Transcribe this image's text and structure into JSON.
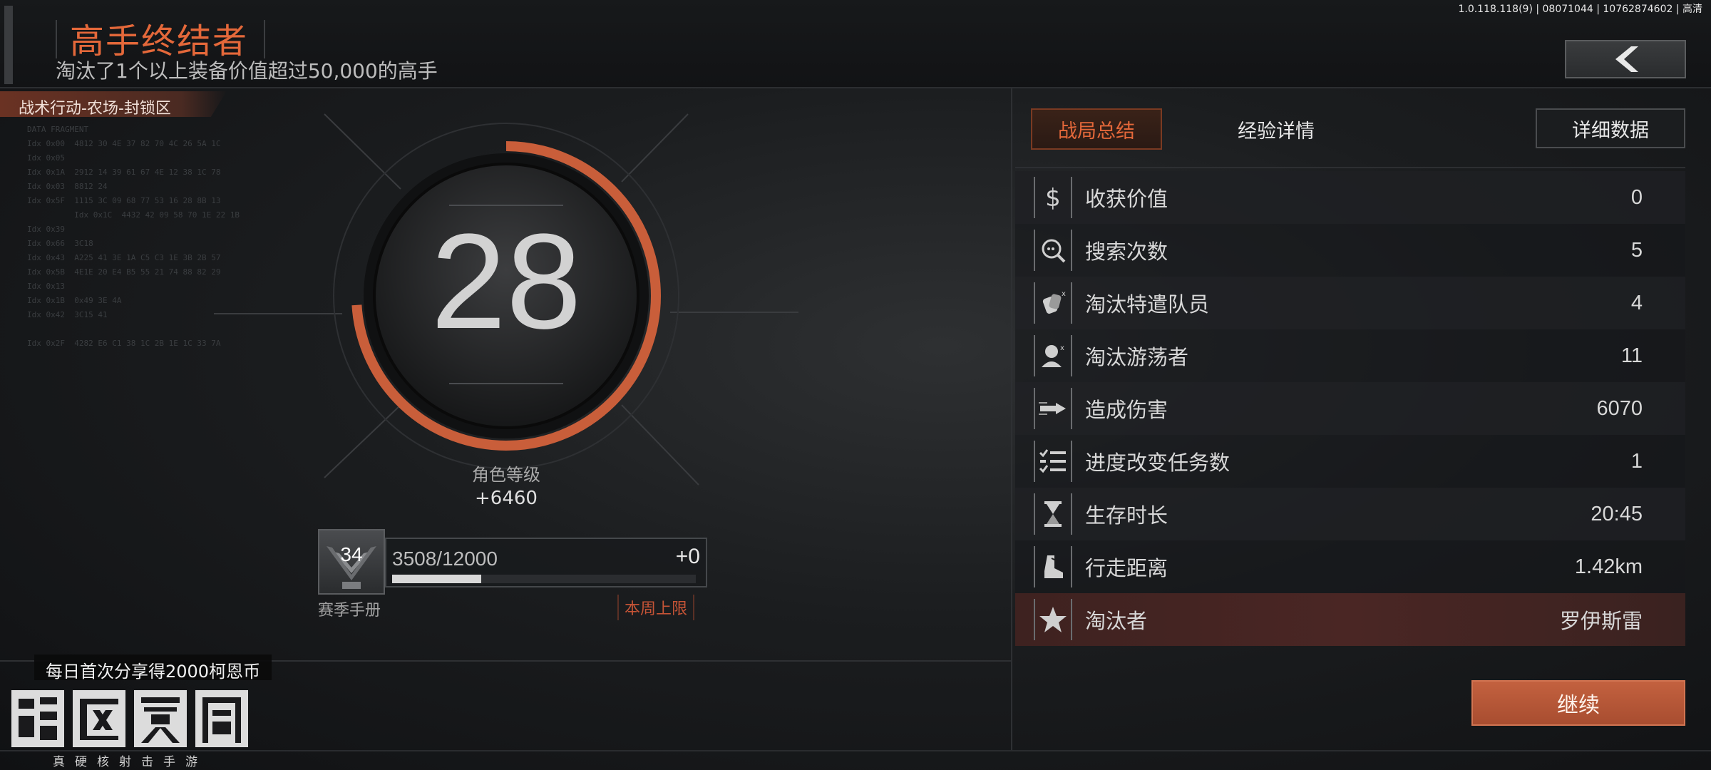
{
  "build_info": "1.0.118.118(9) | 08071044 | 10762874602 | 高清",
  "achievement": {
    "title": "高手终结者",
    "subtitle": "淘汰了1个以上装备价值超过50,000的高手"
  },
  "map_tag": "战术行动-农场-封锁区",
  "fragment": {
    "lines": [
      "DATA FRAGMENT",
      "Idx 0x00  4812 30 4E 37 82 70 4C 26 5A 1C",
      "Idx 0x05",
      "Idx 0x1A  2912 14 39 61 67 4E 12 38 1C 78",
      "Idx 0x03  8812 24",
      "Idx 0x5F  1115 3C 09 68 77 53 16 28 8B 13",
      "          Idx 0x1C  4432 42 09 58 70 1E 22 1B",
      "Idx 0x39",
      "Idx 0x66  3C18",
      "Idx 0x43  A225 41 3E 1A C5 C3 1E 3B 2B 57",
      "Idx 0x5B  4E1E 20 E4 B5 55 21 74 88 82 29",
      "Idx 0x13",
      "Idx 0x1B  0x49 3E 4A",
      "Idx 0x42  3C15 41",
      "",
      "Idx 0x2F  4282 E6 C1 38 1C 2B 1E 1C 33 7A"
    ]
  },
  "level": {
    "value": "28",
    "label": "角色等级",
    "xp_gain": "+6460",
    "ring_progress": 0.74
  },
  "season": {
    "level": "34",
    "label": "赛季手册",
    "progress_text": "3508/12000",
    "progress_fraction": 0.2923,
    "gain": "+0",
    "weekly_cap": "本周上限"
  },
  "share_tip": "每日首次分享得2000柯恩币",
  "logo": {
    "name": "暗区突围",
    "slogan": "真硬核射击手游"
  },
  "tabs": {
    "summary": "战局总结",
    "exp_detail": "经验详情",
    "detail_data": "详细数据"
  },
  "stats": [
    {
      "icon": "dollar-icon",
      "label": "收获价值",
      "value": "0"
    },
    {
      "icon": "search-loot-icon",
      "label": "搜索次数",
      "value": "5"
    },
    {
      "icon": "dogtag-icon",
      "label": "淘汰特遣队员",
      "value": "4"
    },
    {
      "icon": "scav-kill-icon",
      "label": "淘汰游荡者",
      "value": "11"
    },
    {
      "icon": "bullet-icon",
      "label": "造成伤害",
      "value": "6070"
    },
    {
      "icon": "checklist-icon",
      "label": "进度改变任务数",
      "value": "1"
    },
    {
      "icon": "hourglass-icon",
      "label": "生存时长",
      "value": "20:45"
    },
    {
      "icon": "boot-icon",
      "label": "行走距离",
      "value": "1.42km"
    },
    {
      "icon": "star-badge-icon",
      "label": "淘汰者",
      "value": "罗伊斯雷"
    }
  ],
  "continue_label": "继续",
  "colors": {
    "accent": "#e4683a",
    "ring": "#c95e3a",
    "button": "#b5573a",
    "highlight_row": "#472523"
  }
}
